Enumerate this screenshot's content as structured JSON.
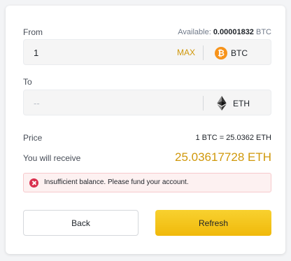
{
  "from": {
    "label": "From",
    "available_label": "Available:",
    "available_amount": "0.00001832",
    "available_unit": "BTC",
    "amount_value": "1",
    "max_label": "MAX",
    "coin_symbol": "BTC",
    "coin_icon": "bitcoin-icon"
  },
  "to": {
    "label": "To",
    "placeholder": "--",
    "coin_symbol": "ETH",
    "coin_icon": "ethereum-icon"
  },
  "price": {
    "label": "Price",
    "value": "1 BTC = 25.0362 ETH"
  },
  "receive": {
    "label": "You will receive",
    "value": "25.03617728 ETH"
  },
  "error": {
    "message": "Insufficient balance. Please fund your account."
  },
  "buttons": {
    "back_label": "Back",
    "refresh_label": "Refresh"
  },
  "colors": {
    "accent": "#f0b90b",
    "accent_text": "#d0980b",
    "error": "#d9304e",
    "bitcoin": "#f7931a"
  }
}
